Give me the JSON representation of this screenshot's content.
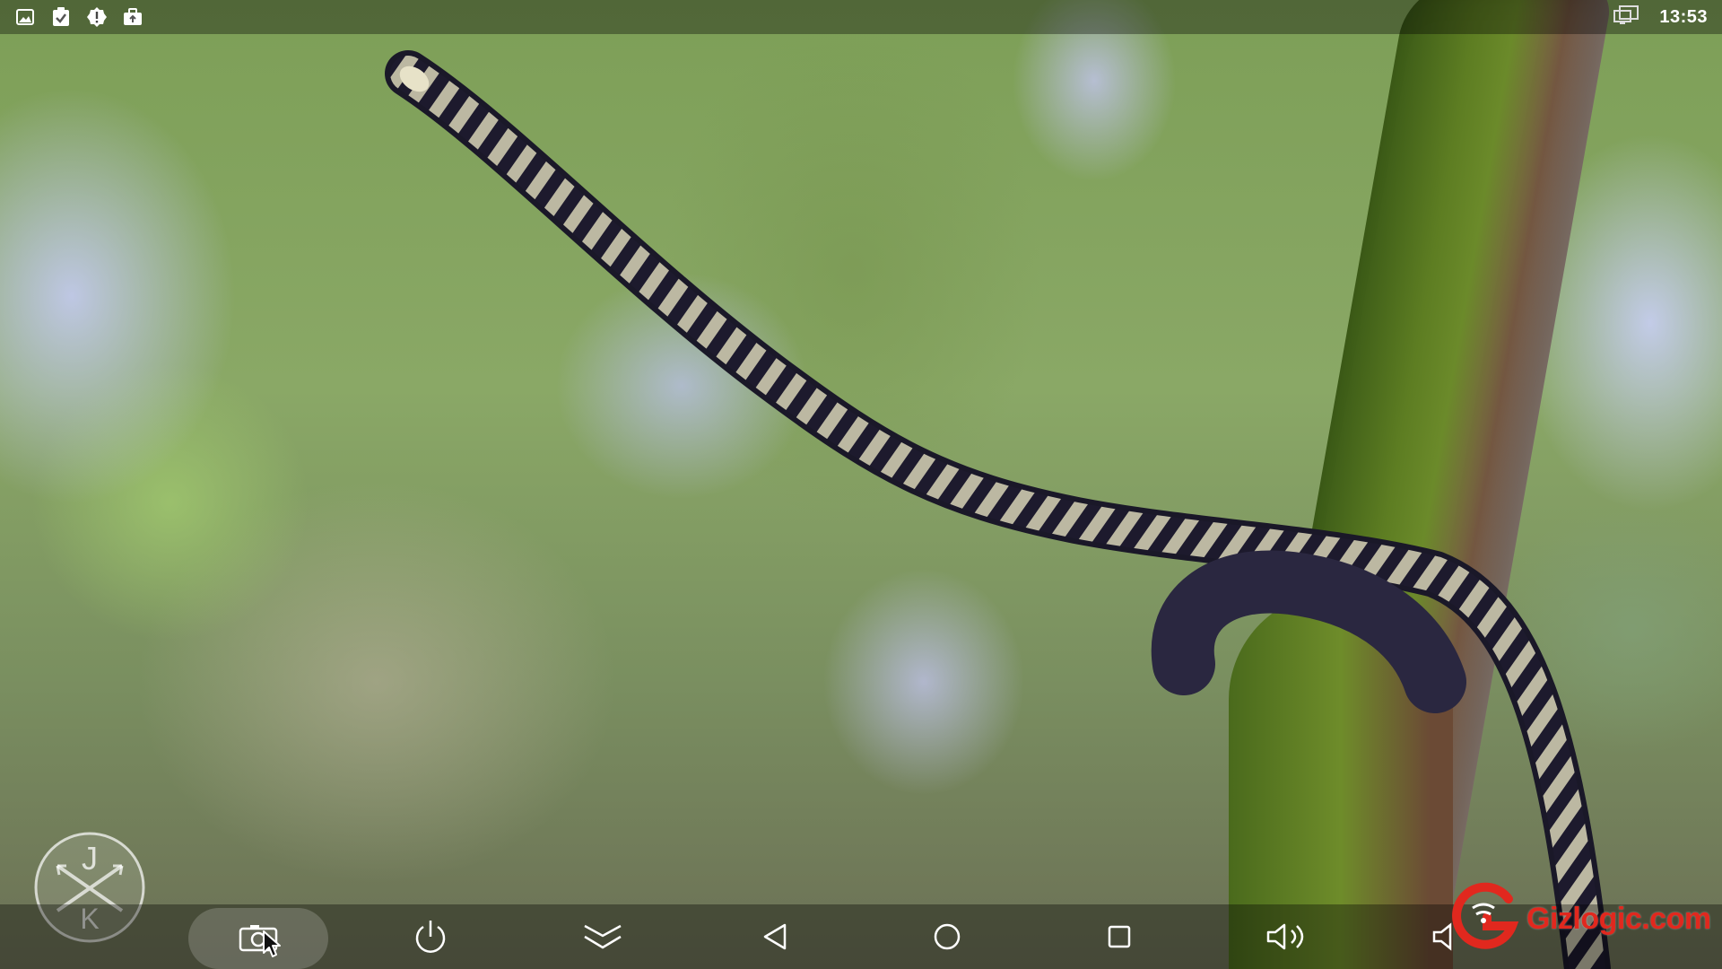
{
  "status_bar": {
    "time": "13:53",
    "notification_icons": [
      "gallery-icon",
      "clipboard-check-icon",
      "alert-badge-icon",
      "briefcase-upload-icon"
    ],
    "system_icons": [
      "network-screen-icon"
    ]
  },
  "nav_bar": {
    "buttons": [
      {
        "name": "screenshot-button",
        "icon": "screenshot-icon"
      },
      {
        "name": "power-button",
        "icon": "power-icon"
      },
      {
        "name": "notifications-pulldown-button",
        "icon": "double-chevron-down-icon"
      },
      {
        "name": "back-button",
        "icon": "back-triangle-icon"
      },
      {
        "name": "home-button",
        "icon": "home-circle-icon"
      },
      {
        "name": "recents-button",
        "icon": "recents-square-icon"
      },
      {
        "name": "volume-button",
        "icon": "volume-icon"
      }
    ]
  },
  "overlay": {
    "corner_logo_letters": [
      "J",
      "K"
    ],
    "watermark": {
      "brand": "Gizlogic",
      "tld": ".com",
      "color": "#e1281e"
    }
  },
  "colors": {
    "bar_background": "rgba(0,0,0,0.35)",
    "icon_color": "#ffffff",
    "watermark_red": "#e1281e"
  }
}
